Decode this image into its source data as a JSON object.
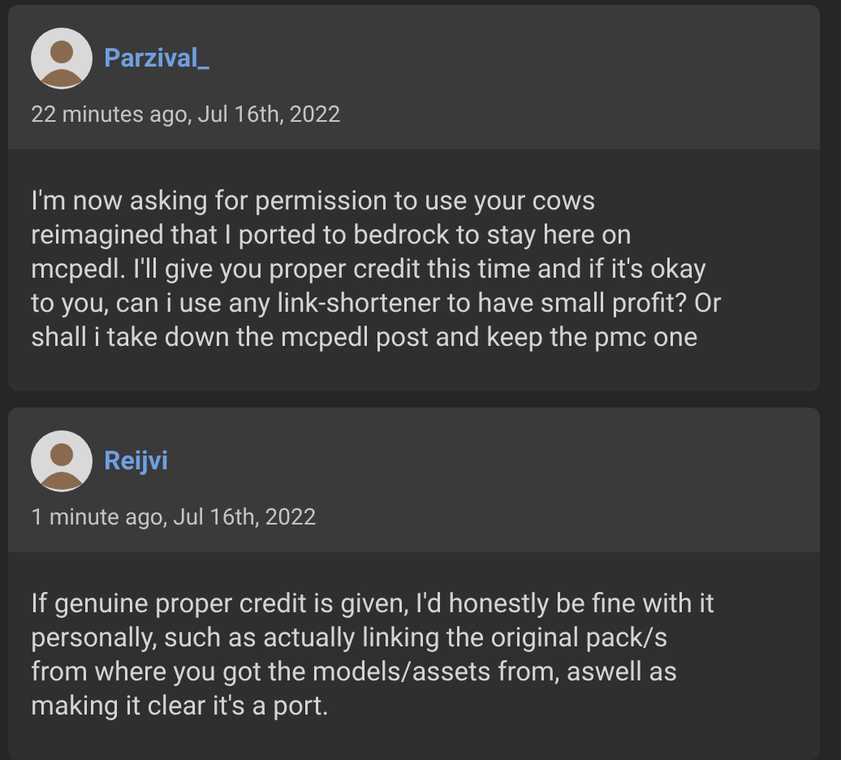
{
  "comments": [
    {
      "author": "Parzival_",
      "time": "22 minutes ago, Jul 16th, 2022",
      "body": "I'm now asking for permission to use your cows reimagined that I ported to bedrock to stay here on mcpedl. I'll give you proper credit this time and if it's okay to you, can i use any link-shortener to have small profit? Or shall i take down the mcpedl post and keep the pmc one"
    },
    {
      "author": "Reijvi",
      "time": "1 minute ago, Jul 16th, 2022",
      "body": "If genuine proper credit is given, I'd honestly be fine with it personally, such as actually linking the original pack/s from where you got the models/assets from, aswell as making it clear it's a port."
    }
  ]
}
